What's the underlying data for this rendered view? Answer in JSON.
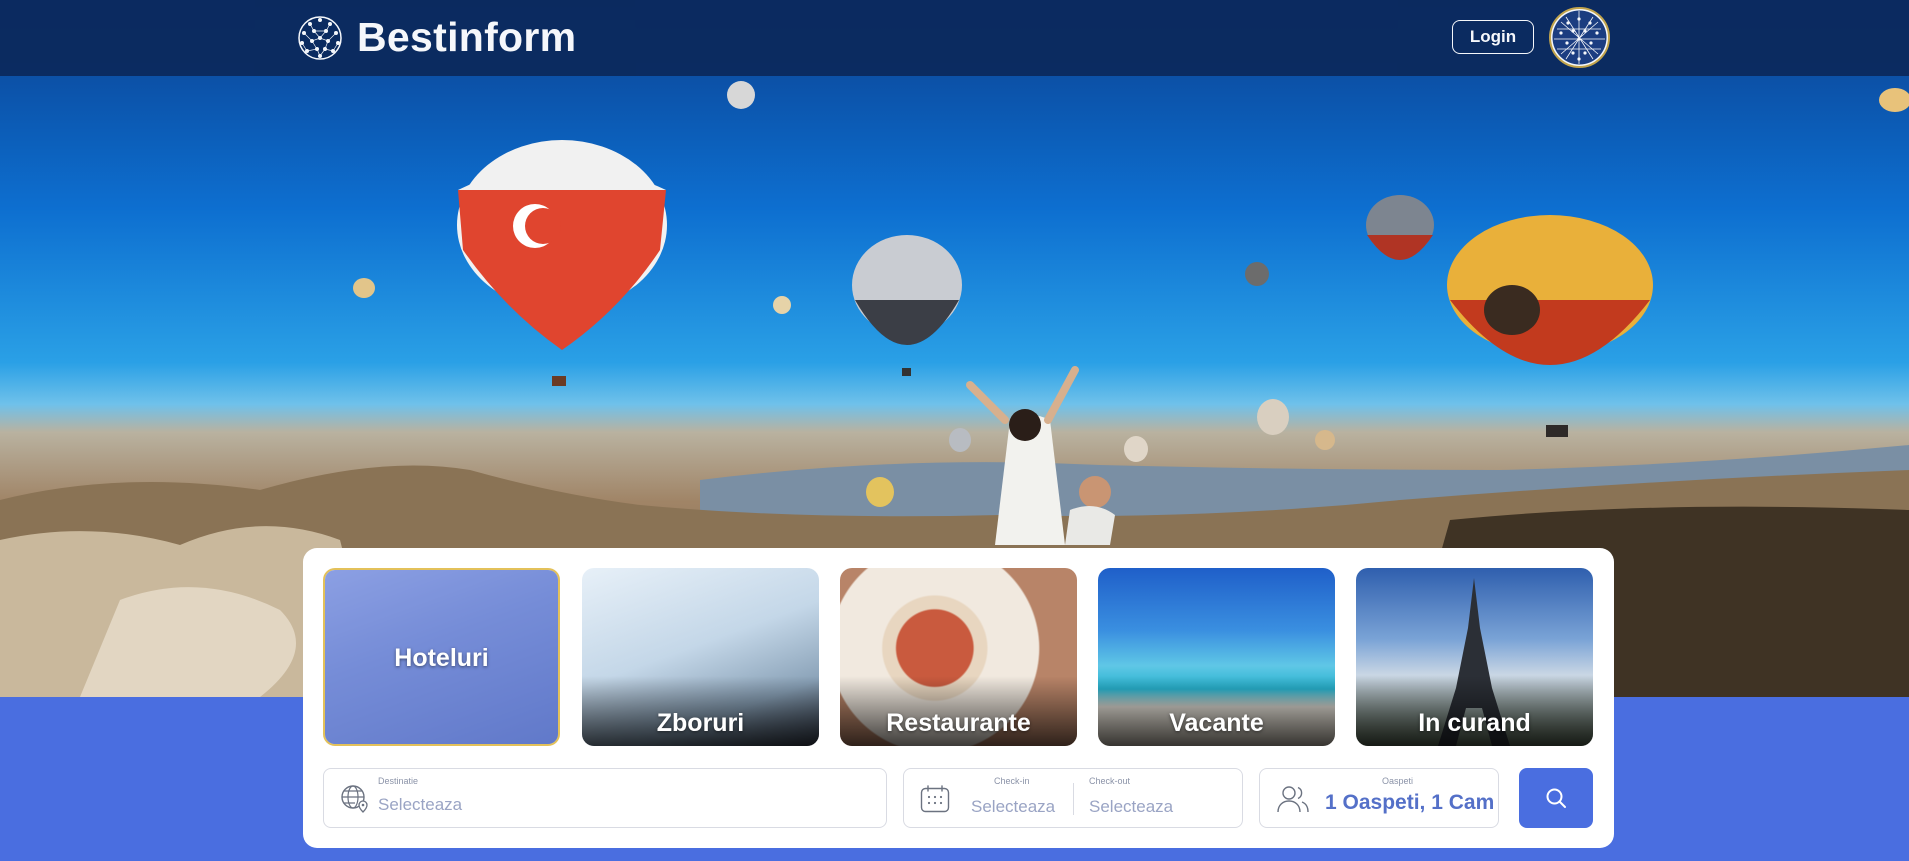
{
  "header": {
    "brand": "Bestinform",
    "login_label": "Login"
  },
  "categories": [
    {
      "label": "Hoteluri",
      "active": true
    },
    {
      "label": "Zboruri",
      "active": false
    },
    {
      "label": "Restaurante",
      "active": false
    },
    {
      "label": "Vacante",
      "active": false
    },
    {
      "label": "In curand",
      "active": false
    }
  ],
  "search": {
    "destination_label": "Destinatie",
    "destination_placeholder": "Selecteaza",
    "checkin_label": "Check-in",
    "checkin_placeholder": "Selecteaza",
    "checkout_label": "Check-out",
    "checkout_placeholder": "Selecteaza",
    "guests_label": "Oaspeti",
    "guests_value": "1 Oaspeti, 1 Cam"
  },
  "colors": {
    "header_bg": "#0b2a5e",
    "accent": "#4a6ee0",
    "active_border": "#e3c15a"
  },
  "icons": {
    "logo": "globe-network-icon",
    "destination": "globe-pin-icon",
    "dates": "calendar-icon",
    "guests": "users-icon",
    "search": "search-icon"
  }
}
